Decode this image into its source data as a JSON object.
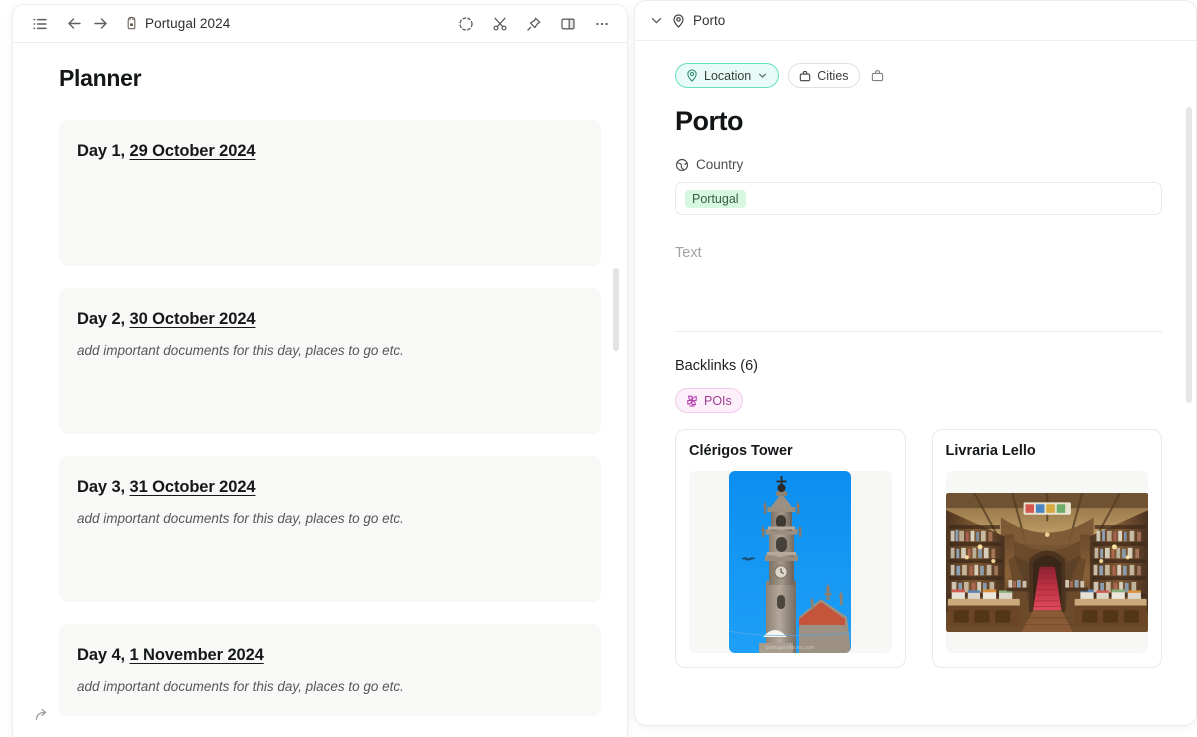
{
  "left_window": {
    "toolbar": {
      "sidebar_toggle": "list-icon",
      "back": "arrow-left-icon",
      "forward": "arrow-right-icon",
      "doc_emoji": "backpack-icon",
      "doc_title": "Portugal 2024",
      "right_icons": [
        "dashed-circle-icon",
        "scissors-icon",
        "pin-icon",
        "split-panel-icon",
        "more-icon"
      ]
    },
    "page_title": "Planner",
    "days": [
      {
        "label": "Day 1,",
        "date": "29 October 2024",
        "note": ""
      },
      {
        "label": "Day 2,",
        "date": "30 October 2024",
        "note": "add important documents for this day, places to go etc."
      },
      {
        "label": "Day 3,",
        "date": "31 October 2024",
        "note": "add important documents for this day, places to go etc."
      },
      {
        "label": "Day 4,",
        "date": "1 November 2024",
        "note": "add important documents for this day, places to go etc."
      }
    ],
    "share_icon": "share-arrow-icon"
  },
  "right_panel": {
    "header": {
      "collapse_icon": "chevron-down-icon",
      "location_pin_icon": "map-pin-icon",
      "title": "Porto"
    },
    "chips": [
      {
        "label": "Location",
        "icon": "map-pin-icon",
        "has_caret": true,
        "style": "teal"
      },
      {
        "label": "Cities",
        "icon": "briefcase-icon",
        "has_caret": false,
        "style": "outline"
      }
    ],
    "extra_chip_icon": "briefcase-icon",
    "record_title": "Porto",
    "country_field": {
      "icon": "globe-icon",
      "label": "Country",
      "value": "Portugal"
    },
    "text_field_placeholder": "Text",
    "backlinks": {
      "heading": "Backlinks (6)",
      "tag": {
        "label": "POIs",
        "icon": "windmill-icon"
      },
      "cards": [
        {
          "title": "Clérigos Tower",
          "image": "clerigos-tower-photo"
        },
        {
          "title": "Livraria Lello",
          "image": "livraria-lello-photo"
        }
      ]
    }
  },
  "colors": {
    "teal_accent": "#64dfc0",
    "teal_bg": "#e9fbf6",
    "green_tag_bg": "#d7f7e2",
    "pink_tag_bg": "#fdf0fb",
    "pink_tag_border": "#f0c9ec",
    "pink_tag_text": "#9c3f92",
    "card_bg": "#f8f8f7"
  }
}
